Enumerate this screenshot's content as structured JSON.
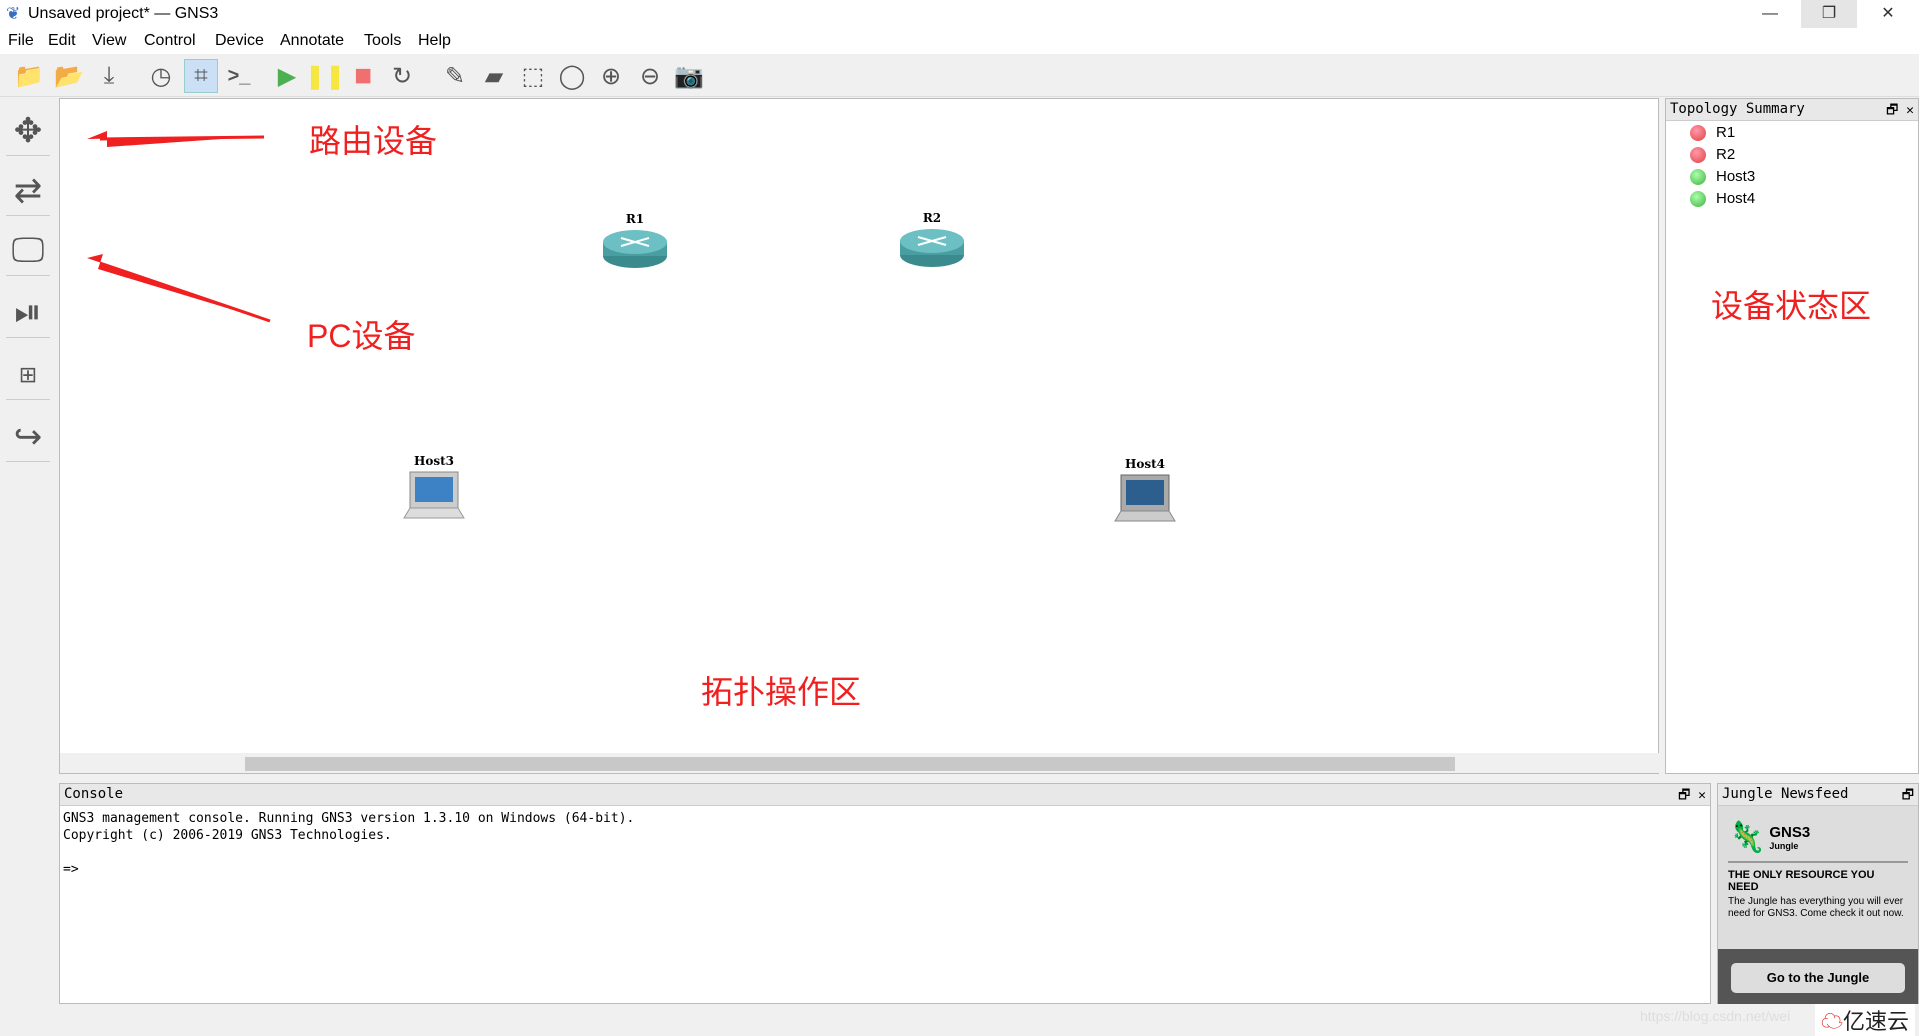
{
  "window": {
    "title": "Unsaved project* — GNS3",
    "min": "—",
    "restore": "❐",
    "close": "✕"
  },
  "menu": [
    "File",
    "Edit",
    "View",
    "Control",
    "Device",
    "Annotate",
    "Tools",
    "Help"
  ],
  "toolbar": [
    "folder-new-icon",
    "folder-open-icon",
    "save-icon",
    "clock-icon",
    "show-labels-icon",
    "console-icon",
    "start-icon",
    "suspend-icon",
    "stop-icon",
    "reload-icon",
    "note-icon",
    "image-icon",
    "rectangle-icon",
    "ellipse-icon",
    "zoom-in-icon",
    "zoom-out-icon",
    "screenshot-icon"
  ],
  "colors": {
    "start": "#4caf50",
    "suspend": "#f5e642",
    "stop": "#f07070",
    "annotation": "#f02020",
    "stopped": "#e04040",
    "running": "#40b040"
  },
  "canvas": {
    "devices": [
      {
        "name": "R1",
        "type": "router"
      },
      {
        "name": "R2",
        "type": "router"
      },
      {
        "name": "Host3",
        "type": "host"
      },
      {
        "name": "Host4",
        "type": "host"
      }
    ],
    "annotations": {
      "routers": "路由设备",
      "pcs": "PC设备",
      "status_area": "设备状态区",
      "topology_area": "拓扑操作区"
    }
  },
  "topology": {
    "title": "Topology Summary",
    "items": [
      {
        "name": "R1",
        "status": "stopped"
      },
      {
        "name": "R2",
        "status": "stopped"
      },
      {
        "name": "Host3",
        "status": "running"
      },
      {
        "name": "Host4",
        "status": "running"
      }
    ]
  },
  "console": {
    "title": "Console",
    "text": "GNS3 management console. Running GNS3 version 1.3.10 on Windows (64-bit).\nCopyright (c) 2006-2019 GNS3 Technologies.\n\n=>"
  },
  "jungle": {
    "title": "Jungle Newsfeed",
    "logo": "GNS3",
    "logo_sub": "Jungle",
    "headline": "THE ONLY RESOURCE YOU NEED",
    "body": "The Jungle has everything you will ever need for GNS3. Come check it out now.",
    "button": "Go to the Jungle"
  },
  "watermark": {
    "url": "https://blog.csdn.net/wei",
    "brand": "亿速云"
  }
}
